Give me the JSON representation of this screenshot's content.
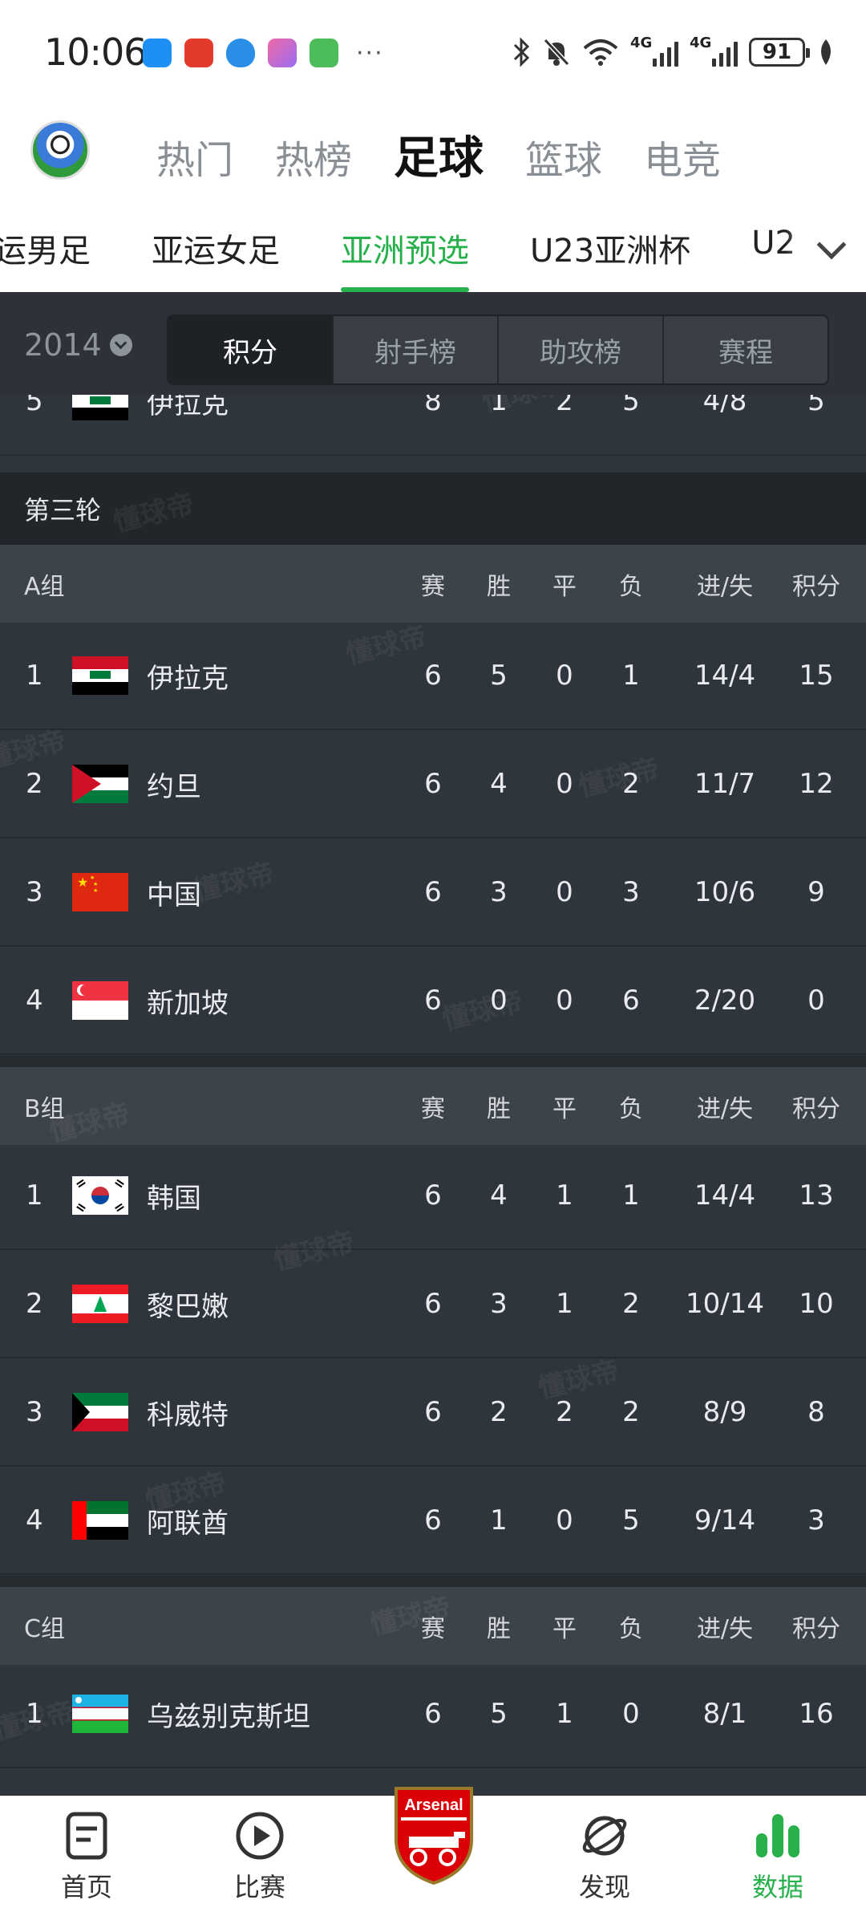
{
  "status_bar": {
    "time": "10:06",
    "battery": "91",
    "signal1": "4G",
    "signal2": "4G",
    "more": "···"
  },
  "main_nav": {
    "tabs": [
      "热门",
      "热榜",
      "足球",
      "篮球",
      "电竞"
    ],
    "active": "足球"
  },
  "sub_nav": {
    "tabs": [
      "亚运男足",
      "亚运女足",
      "亚洲预选",
      "U23亚洲杯",
      "U2"
    ],
    "active": "亚洲预选"
  },
  "filter": {
    "season": "2014",
    "segments": [
      "积分",
      "射手榜",
      "助攻榜",
      "赛程"
    ],
    "active": "积分"
  },
  "previous_row": {
    "rank": "5",
    "team": "伊拉克",
    "p": "8",
    "w": "1",
    "d": "2",
    "l": "5",
    "gf_ga": "4/8",
    "pts": "5"
  },
  "round": {
    "title": "第三轮"
  },
  "columns": {
    "played": "赛",
    "won": "胜",
    "drawn": "平",
    "lost": "负",
    "goals": "进/失",
    "points": "积分"
  },
  "groups": [
    {
      "name": "A组",
      "rows": [
        {
          "rank": "1",
          "team": "伊拉克",
          "flag": "iraq",
          "p": "6",
          "w": "5",
          "d": "0",
          "l": "1",
          "gf_ga": "14/4",
          "pts": "15"
        },
        {
          "rank": "2",
          "team": "约旦",
          "flag": "jordan",
          "p": "6",
          "w": "4",
          "d": "0",
          "l": "2",
          "gf_ga": "11/7",
          "pts": "12"
        },
        {
          "rank": "3",
          "team": "中国",
          "flag": "china",
          "p": "6",
          "w": "3",
          "d": "0",
          "l": "3",
          "gf_ga": "10/6",
          "pts": "9"
        },
        {
          "rank": "4",
          "team": "新加坡",
          "flag": "singapore",
          "p": "6",
          "w": "0",
          "d": "0",
          "l": "6",
          "gf_ga": "2/20",
          "pts": "0"
        }
      ]
    },
    {
      "name": "B组",
      "rows": [
        {
          "rank": "1",
          "team": "韩国",
          "flag": "korea",
          "p": "6",
          "w": "4",
          "d": "1",
          "l": "1",
          "gf_ga": "14/4",
          "pts": "13"
        },
        {
          "rank": "2",
          "team": "黎巴嫩",
          "flag": "lebanon",
          "p": "6",
          "w": "3",
          "d": "1",
          "l": "2",
          "gf_ga": "10/14",
          "pts": "10"
        },
        {
          "rank": "3",
          "team": "科威特",
          "flag": "kuwait",
          "p": "6",
          "w": "2",
          "d": "2",
          "l": "2",
          "gf_ga": "8/9",
          "pts": "8"
        },
        {
          "rank": "4",
          "team": "阿联酋",
          "flag": "uae",
          "p": "6",
          "w": "1",
          "d": "0",
          "l": "5",
          "gf_ga": "9/14",
          "pts": "3"
        }
      ]
    },
    {
      "name": "C组",
      "rows": [
        {
          "rank": "1",
          "team": "乌兹别克斯坦",
          "flag": "uzbekistan",
          "p": "6",
          "w": "5",
          "d": "1",
          "l": "0",
          "gf_ga": "8/1",
          "pts": "16"
        }
      ]
    }
  ],
  "watermark": "懂球帝",
  "bottom_nav": {
    "items": [
      {
        "label": "首页",
        "icon": "home-doc-icon"
      },
      {
        "label": "比赛",
        "icon": "play-circle-icon"
      },
      {
        "label": "",
        "icon": "arsenal-crest-icon"
      },
      {
        "label": "发现",
        "icon": "planet-icon"
      },
      {
        "label": "数据",
        "icon": "bar-chart-icon"
      }
    ],
    "active": "数据",
    "crest_text": "Arsenal"
  },
  "colors": {
    "accent": "#27b04b",
    "panel_bg": "#2f353c",
    "header_row_bg": "#3d434a",
    "round_bg": "#21262b"
  }
}
